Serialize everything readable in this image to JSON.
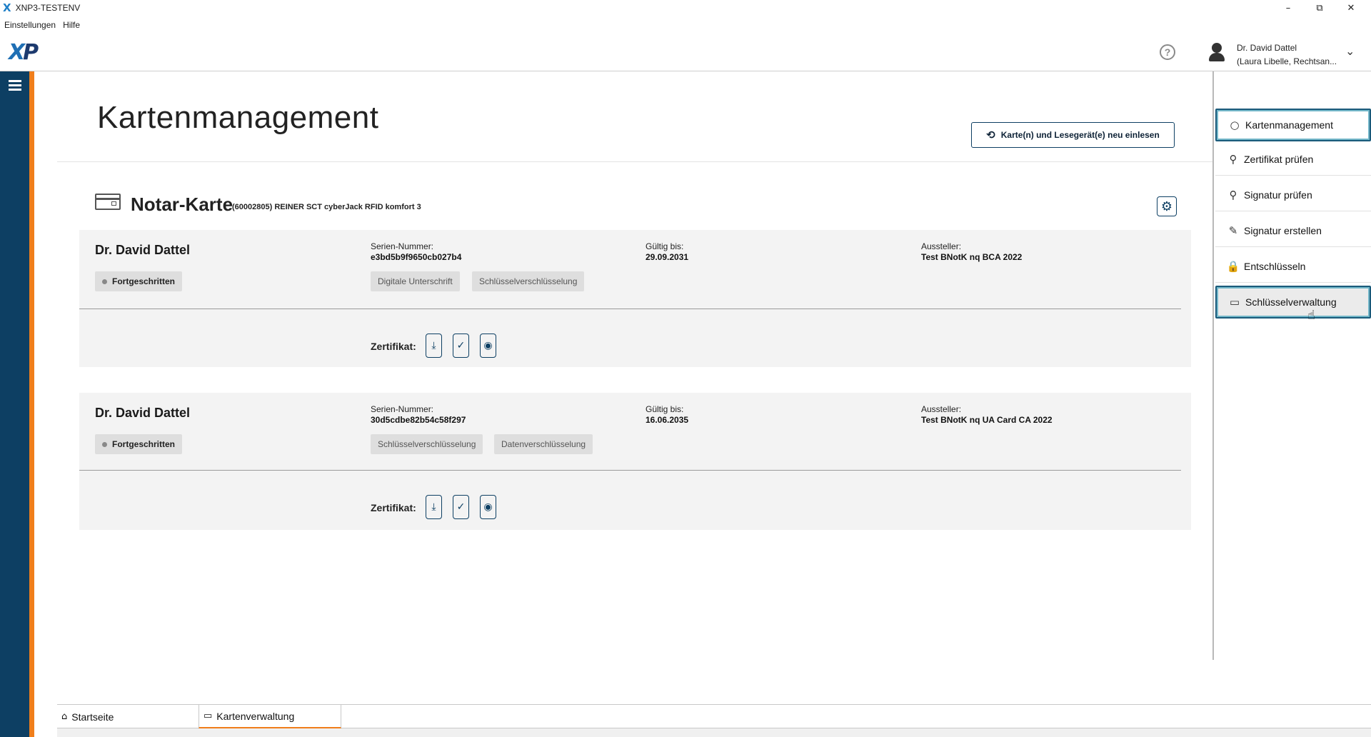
{
  "window": {
    "title": "XNP3-TESTENV",
    "minimize": "–",
    "restore": "⧉",
    "close": "✕"
  },
  "menu": {
    "settings": "Einstellungen",
    "help": "Hilfe"
  },
  "header": {
    "logo_x": "X",
    "logo_p": "P",
    "help_glyph": "?",
    "user_name": "Dr. David Dattel",
    "user_role": "(Laura Libelle, Rechtsan...",
    "chevron": "⌄"
  },
  "page": {
    "title": "Kartenmanagement",
    "reload_button": "Karte(n) und Lesegerät(e) neu einlesen",
    "reload_icon": "⟲"
  },
  "card": {
    "title": "Notar-Karte",
    "subtitle": "(60002805) REINER SCT cyberJack RFID komfort 3",
    "settings_icon": "⚙"
  },
  "certificates": [
    {
      "owner": "Dr. David Dattel",
      "level": "Fortgeschritten",
      "serial_label": "Serien-Nummer:",
      "serial": "e3bd5b9f9650cb027b4",
      "valid_label": "Gültig bis:",
      "valid": "29.09.2031",
      "issuer_label": "Aussteller:",
      "issuer": "Test BNotK nq BCA 2022",
      "usages": [
        "Digitale Unterschrift",
        "Schlüsselverschlüsselung"
      ],
      "zert_label": "Zertifikat:"
    },
    {
      "owner": "Dr. David Dattel",
      "level": "Fortgeschritten",
      "serial_label": "Serien-Nummer:",
      "serial": "30d5cdbe82b54c58f297",
      "valid_label": "Gültig bis:",
      "valid": "16.06.2035",
      "issuer_label": "Aussteller:",
      "issuer": "Test BNotK nq UA Card CA 2022",
      "usages": [
        "Schlüsselverschlüsselung",
        "Datenverschlüsselung"
      ],
      "zert_label": "Zertifikat:"
    }
  ],
  "cert_actions": {
    "download": "⤓",
    "verify": "✓",
    "view": "◉"
  },
  "sidebar": {
    "items": [
      {
        "label": "Kartenmanagement",
        "icon": "○"
      },
      {
        "label": "Zertifikat prüfen",
        "icon": "⚲"
      },
      {
        "label": "Signatur prüfen",
        "icon": "⚲"
      },
      {
        "label": "Signatur erstellen",
        "icon": "✎"
      },
      {
        "label": "Entschlüsseln",
        "icon": "🔒"
      },
      {
        "label": "Schlüsselverwaltung",
        "icon": "▭"
      }
    ]
  },
  "bottom_tabs": [
    {
      "label": "Startseite",
      "icon": "⌂"
    },
    {
      "label": "Kartenverwaltung",
      "icon": "▭"
    }
  ],
  "colors": {
    "brand_dark": "#0d3f63",
    "accent_orange": "#f07e1b",
    "active_outline": "#73b7c9"
  }
}
